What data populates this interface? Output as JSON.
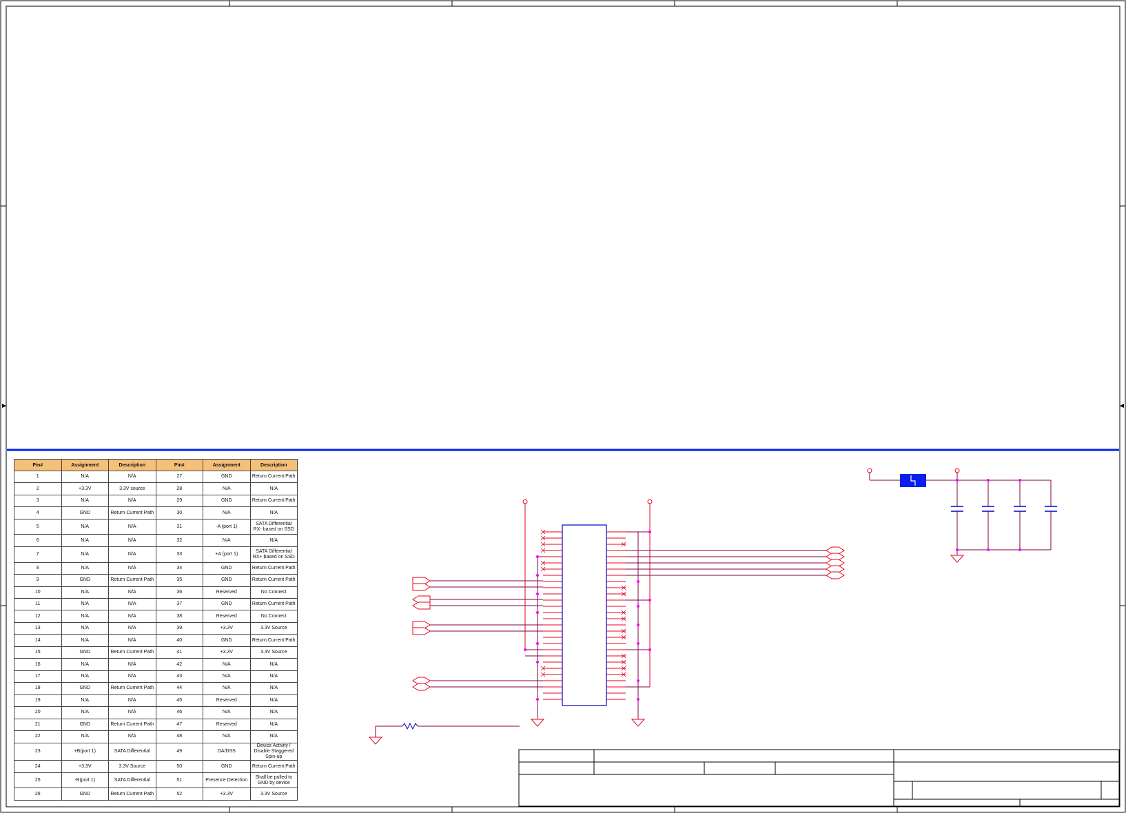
{
  "pin_table": {
    "headers": [
      "Pin#",
      "Assignment",
      "Description",
      "Pin#",
      "Assignment",
      "Description"
    ],
    "rows": [
      [
        "1",
        "N/A",
        "N/A",
        "27",
        "GND",
        "Return Current Path"
      ],
      [
        "2",
        "+3.3V",
        "3.3V source",
        "28",
        "N/A",
        "N/A"
      ],
      [
        "3",
        "N/A",
        "N/A",
        "29",
        "GND",
        "Return Current Path"
      ],
      [
        "4",
        "GND",
        "Return Current Path",
        "30",
        "N/A",
        "N/A"
      ],
      [
        "5",
        "N/A",
        "N/A",
        "31",
        "-A (port 1)",
        "SATA Differential RX- based on SSD"
      ],
      [
        "6",
        "N/A",
        "N/A",
        "32",
        "N/A",
        "N/A"
      ],
      [
        "7",
        "N/A",
        "N/A",
        "33",
        "+A (port 1)",
        "SATA Differential RX+ based on SSD"
      ],
      [
        "8",
        "N/A",
        "N/A",
        "34",
        "GND",
        "Return Current Path"
      ],
      [
        "9",
        "GND",
        "Return Current Path",
        "35",
        "GND",
        "Return Current Path"
      ],
      [
        "10",
        "N/A",
        "N/A",
        "36",
        "Reserved",
        "No Connect"
      ],
      [
        "11",
        "N/A",
        "N/A",
        "37",
        "GND",
        "Return Current Path"
      ],
      [
        "12",
        "N/A",
        "N/A",
        "38",
        "Reserved",
        "No Connect"
      ],
      [
        "13",
        "N/A",
        "N/A",
        "39",
        "+3.3V",
        "3.3V Source"
      ],
      [
        "14",
        "N/A",
        "N/A",
        "40",
        "GND",
        "Return Current Path"
      ],
      [
        "15",
        "GND",
        "Return Current Path",
        "41",
        "+3.3V",
        "3.3V Source"
      ],
      [
        "16",
        "N/A",
        "N/A",
        "42",
        "N/A",
        "N/A"
      ],
      [
        "17",
        "N/A",
        "N/A",
        "43",
        "N/A",
        "N/A"
      ],
      [
        "18",
        "GND",
        "Return Current Path",
        "44",
        "N/A",
        "N/A"
      ],
      [
        "19",
        "N/A",
        "N/A",
        "45",
        "Reserved",
        "N/A"
      ],
      [
        "20",
        "N/A",
        "N/A",
        "46",
        "N/A",
        "N/A"
      ],
      [
        "21",
        "GND",
        "Return Current Path",
        "47",
        "Reserved",
        "N/A"
      ],
      [
        "22",
        "N/A",
        "N/A",
        "48",
        "N/A",
        "N/A"
      ],
      [
        "23",
        "+B(port 1)",
        "SATA Differential",
        "49",
        "DA/DSS",
        "Device Activity / Disable Staggered Spin-up"
      ],
      [
        "24",
        "+3.3V",
        "3.3V Source",
        "50",
        "GND",
        "Return Current Path"
      ],
      [
        "25",
        "-B(port 1)",
        "SATA Differential",
        "51",
        "Presence Detection",
        "Shall be pulled to GND by device"
      ],
      [
        "26",
        "GND",
        "Return Current Path",
        "52",
        "+3.3V",
        "3.3V Source"
      ]
    ],
    "tall_rows": [
      4,
      6,
      22,
      24
    ]
  },
  "colors": {
    "wire": "#e8001c",
    "net": "#800040",
    "junction": "#ff00ff",
    "part": "#0000cc",
    "ferrite": "#0a1ef0",
    "frame": "#000000",
    "divider": "#0022ee",
    "header_fill": "#f5c07a"
  }
}
